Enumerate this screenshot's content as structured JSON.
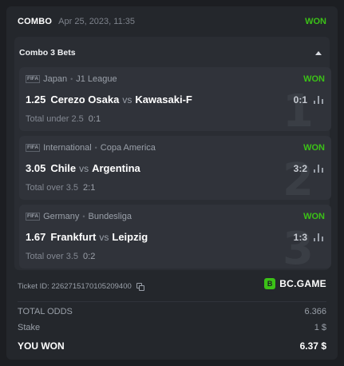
{
  "header": {
    "type": "COMBO",
    "datetime": "Apr 25, 2023, 11:35",
    "status": "WON",
    "status_color": "#3bc117"
  },
  "accordion": {
    "title": "Combo 3 Bets",
    "toggle_icon": "triangle-up-icon"
  },
  "bets": [
    {
      "index": "1",
      "sport_icon": "fifa-icon",
      "country": "Japan",
      "league": "J1 League",
      "status": "WON",
      "odds": "1.25",
      "home": "Cerezo Osaka",
      "vs": "vs",
      "away": "Kawasaki-F",
      "score": "0:1",
      "market": "Total under 2.5",
      "result": "0:1"
    },
    {
      "index": "2",
      "sport_icon": "fifa-icon",
      "country": "International",
      "league": "Copa America",
      "status": "WON",
      "odds": "3.05",
      "home": "Chile",
      "vs": "vs",
      "away": "Argentina",
      "score": "3:2",
      "market": "Total over 3.5",
      "result": "2:1"
    },
    {
      "index": "3",
      "sport_icon": "fifa-icon",
      "country": "Germany",
      "league": "Bundesliga",
      "status": "WON",
      "odds": "1.67",
      "home": "Frankfurt",
      "vs": "vs",
      "away": "Leipzig",
      "score": "1:3",
      "market": "Total over 3.5",
      "result": "0:2"
    }
  ],
  "ticket": {
    "label": "Ticket ID: 2262715170105209400",
    "copy_icon": "copy-icon"
  },
  "brand": {
    "logo_letter": "B",
    "name": "BC.GAME"
  },
  "summary": {
    "total_odds_label": "TOTAL ODDS",
    "total_odds_value": "6.366",
    "stake_label": "Stake",
    "stake_value": "1 $",
    "won_label": "YOU WON",
    "won_value": "6.37 $"
  }
}
